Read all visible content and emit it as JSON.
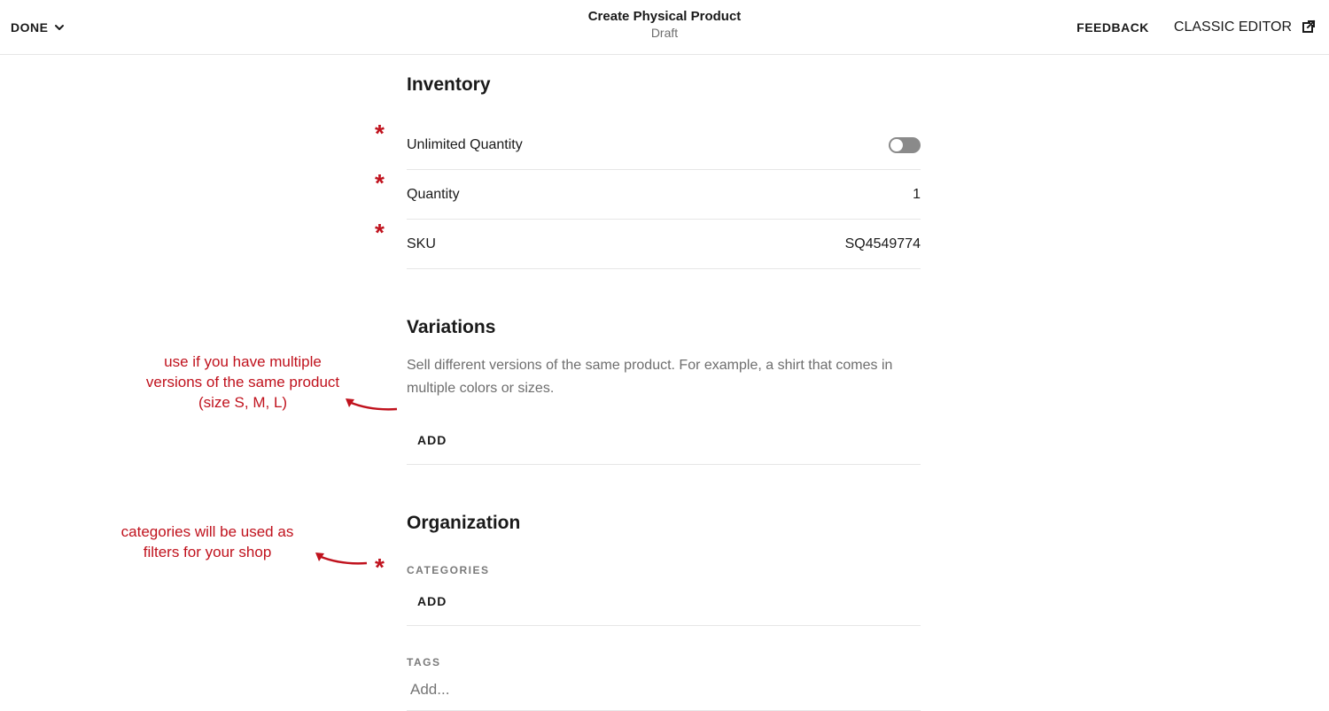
{
  "header": {
    "done_label": "DONE",
    "title": "Create Physical Product",
    "status": "Draft",
    "feedback_label": "FEEDBACK",
    "classic_editor_label": "CLASSIC EDITOR"
  },
  "inventory": {
    "title": "Inventory",
    "unlimited_label": "Unlimited Quantity",
    "unlimited_on": false,
    "quantity_label": "Quantity",
    "quantity_value": "1",
    "sku_label": "SKU",
    "sku_value": "SQ4549774"
  },
  "variations": {
    "title": "Variations",
    "description": "Sell different versions of the same product. For example, a shirt that comes in multiple colors or sizes.",
    "add_label": "ADD"
  },
  "organization": {
    "title": "Organization",
    "categories_label": "CATEGORIES",
    "categories_add_label": "ADD",
    "tags_label": "TAGS",
    "tags_placeholder": "Add..."
  },
  "annotations": {
    "variations_note": "use if you have multiple versions of the same product (size S, M, L)",
    "categories_note": "categories will be used as filters for your shop"
  },
  "colors": {
    "accent": "#c0121d"
  }
}
